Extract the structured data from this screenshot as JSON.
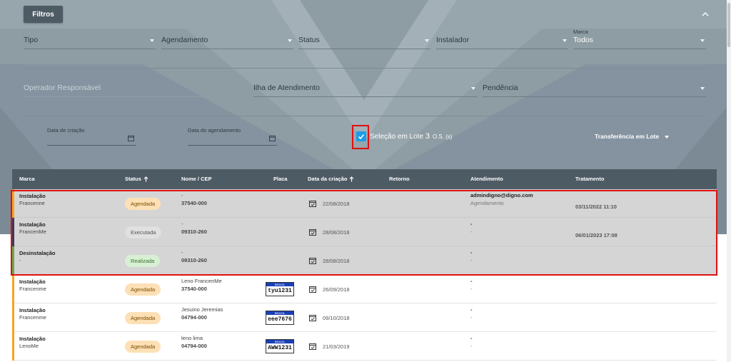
{
  "filters": {
    "button_label": "Filtros",
    "tipo": "Tipo",
    "agendamento": "Agendamento",
    "status": "Status",
    "instalador": "Instalador",
    "marca_label": "Marca",
    "marca_value": "Todos",
    "operador": "Operador Responsável",
    "ilha": "Ilha de Atendimento",
    "pendencia": "Pendência",
    "data_criacao": "Data de criação",
    "data_agendamento": "Data do agendamento"
  },
  "lote": {
    "label": "Seleção em Lote",
    "count": "3",
    "unit": "O.S. (s)",
    "transfer_label": "Transferência em Lote"
  },
  "table": {
    "headers": {
      "marca": "Marca",
      "status": "Status",
      "nome": "Nome / CEP",
      "placa": "Placa",
      "data": "Data da criação",
      "retorno": "Retorno",
      "atendimento": "Atendimento",
      "tratamento": "Tratamento"
    },
    "rows": [
      {
        "tipo": "Instalação",
        "marca": "Francenne",
        "status": "Agendada",
        "nome": "-",
        "cep": "37540-000",
        "placa": "",
        "data": "22/08/2018",
        "atd1": "admindigno@digno.com",
        "atd2": "Agendamento",
        "trat": "03/11/2022 11:10"
      },
      {
        "tipo": "Instalação",
        "marca": "FrancenMe",
        "status": "Executada",
        "nome": "-",
        "cep": "09310-260",
        "placa": "",
        "data": "28/08/2018",
        "atd1": "-",
        "atd2": "-",
        "trat": "06/01/2023 17:08"
      },
      {
        "tipo": "Desinstalação",
        "marca": "-",
        "status": "Realizada",
        "nome": "-",
        "cep": "09310-260",
        "placa": "",
        "data": "28/08/2018",
        "atd1": "-",
        "atd2": "-",
        "trat": ""
      },
      {
        "tipo": "Instalação",
        "marca": "Francenme",
        "status": "Agendada",
        "nome": "Leno FrancenMe",
        "cep": "37540-000",
        "placa": "tyu1231",
        "data": "26/09/2018",
        "atd1": "-",
        "atd2": "-",
        "trat": ""
      },
      {
        "tipo": "Instalação",
        "marca": "Francenme",
        "status": "Agendada",
        "nome": "Jesuino Jeremias",
        "cep": "04794-000",
        "placa": "eee7676",
        "data": "09/10/2018",
        "atd1": "-",
        "atd2": "-",
        "trat": ""
      },
      {
        "tipo": "Instalação",
        "marca": "LenoMe",
        "status": "Agendada",
        "nome": "leno lima",
        "cep": "04794-000",
        "placa": "AWW1231",
        "data": "21/03/2019",
        "atd1": "-",
        "atd2": "-",
        "trat": ""
      }
    ],
    "plate_country": "BRASIL"
  },
  "colors": {
    "agendada": "#f5a623",
    "executada": "#3d3a5c",
    "realizada": "#6aa84f",
    "header_bg": "#4d5b64",
    "accent": "#1e9be8",
    "highlight": "#e01010"
  }
}
